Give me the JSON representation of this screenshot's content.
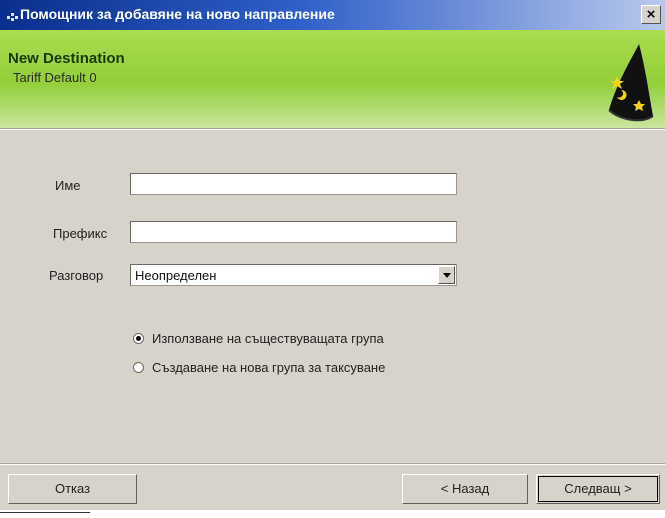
{
  "window": {
    "title": "Помощник за добавяне на ново направление",
    "close_glyph": "×"
  },
  "header": {
    "title": "New Destination",
    "subtitle": "Tariff Default 0",
    "icon": "wizard-hat-icon"
  },
  "form": {
    "name_label": "Име",
    "name_value": "",
    "prefix_label": "Префикс",
    "prefix_value": "",
    "call_label": "Разговор",
    "call_value": "Неопределен"
  },
  "options": {
    "use_existing_label": "Използване на съществуващата група",
    "create_new_label": "Създаване на нова група за таксуване",
    "selected": "use_existing"
  },
  "buttons": {
    "cancel_label": "Отказ",
    "back_label": "< Назад",
    "next_label": "Следващ >"
  },
  "colors": {
    "title_bar": "#0a2e8c",
    "header_green": "#93cf3a",
    "dialog_bg": "#d7d3cb"
  }
}
